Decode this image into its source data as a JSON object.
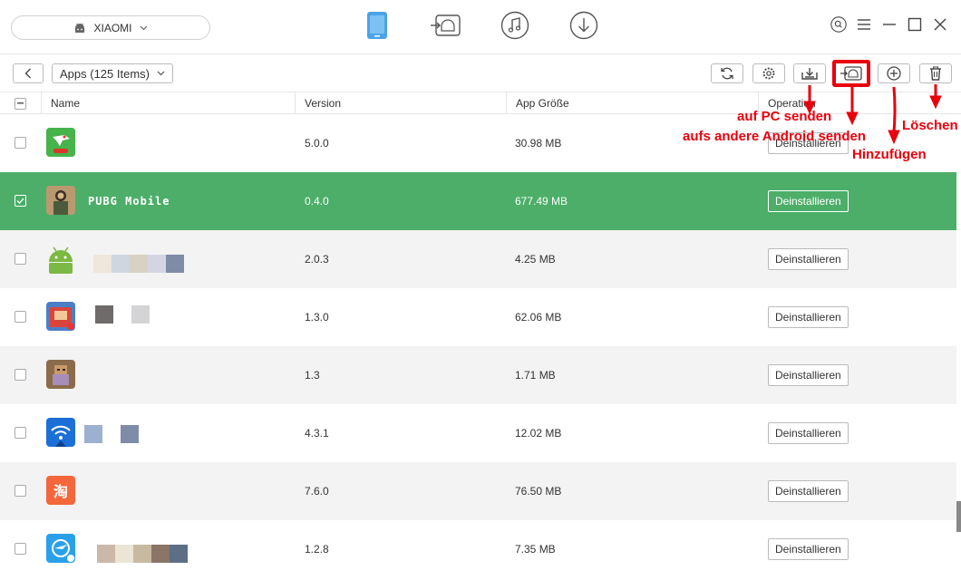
{
  "device": {
    "name": "XIAOMI"
  },
  "nav": {
    "items": [
      {
        "icon": "phone-icon"
      },
      {
        "icon": "android-transfer-icon"
      },
      {
        "icon": "music-icon"
      },
      {
        "icon": "download-icon"
      }
    ]
  },
  "window_controls": [
    "search-icon",
    "menu-icon",
    "minimize-icon",
    "maximize-icon",
    "close-icon"
  ],
  "toolbar": {
    "category": "Apps (125 Items)",
    "buttons": [
      "refresh-icon",
      "settings-icon",
      "export-to-pc-icon",
      "send-to-android-icon",
      "add-icon",
      "delete-icon"
    ]
  },
  "table": {
    "columns": {
      "name": "Name",
      "version": "Version",
      "size": "App Größe",
      "operation": "Operation"
    },
    "uninstall_label": "Deinstallieren",
    "rows": [
      {
        "name": "",
        "version": "5.0.0",
        "size": "30.98 MB",
        "selected": false
      },
      {
        "name": "PUBG Mobile",
        "version": "0.4.0",
        "size": "677.49 MB",
        "selected": true
      },
      {
        "name": "",
        "version": "2.0.3",
        "size": "4.25 MB",
        "selected": false
      },
      {
        "name": "",
        "version": "1.3.0",
        "size": "62.06 MB",
        "selected": false
      },
      {
        "name": "",
        "version": "1.3",
        "size": "1.71 MB",
        "selected": false
      },
      {
        "name": "",
        "version": "4.3.1",
        "size": "12.02 MB",
        "selected": false
      },
      {
        "name": "",
        "version": "7.6.0",
        "size": "76.50 MB",
        "selected": false
      },
      {
        "name": "",
        "version": "1.2.8",
        "size": "7.35 MB",
        "selected": false
      }
    ]
  },
  "annotations": {
    "send_pc": "auf PC senden",
    "send_android": "aufs andere Android senden",
    "add": "Hinzufügen",
    "delete": "Löschen"
  },
  "colors": {
    "selected_row": "#4cae68",
    "annotation": "#e8000c",
    "nav_active": "#4aa3e8"
  }
}
